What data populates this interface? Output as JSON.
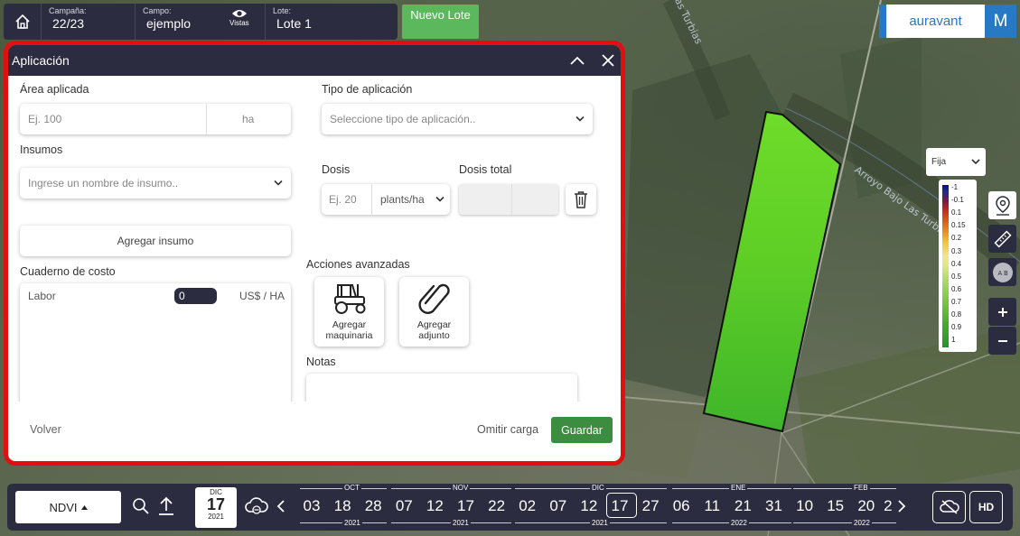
{
  "topbar": {
    "campana_label": "Campaña:",
    "campana_value": "22/23",
    "campo_label": "Campo:",
    "campo_value": "ejemplo",
    "vistas_label": "Vistas",
    "lote_label": "Lote:",
    "lote_value": "Lote 1",
    "nuevo_lote_label": "Nuevo Lote"
  },
  "brand": {
    "logo_text": "auravant",
    "user_initial": "M",
    "color": "#2779c4"
  },
  "map": {
    "labels": [
      "Las Turbias",
      "Arroyo Bajo Las Turbias"
    ]
  },
  "dialog": {
    "title": "Aplicación",
    "area": {
      "label": "Área aplicada",
      "placeholder": "Ej. 100",
      "unit": "ha"
    },
    "tipo": {
      "label": "Tipo de aplicación",
      "placeholder": "Seleccione tipo de aplicación.."
    },
    "insumos": {
      "label": "Insumos",
      "placeholder": "Ingrese un nombre de insumo.."
    },
    "dosis": {
      "label": "Dosis",
      "placeholder": "Ej. 20",
      "unit": "plants/ha"
    },
    "dosis_total": {
      "label": "Dosis total"
    },
    "agregar_insumo": "Agregar insumo",
    "cuaderno": {
      "label": "Cuaderno de costo",
      "labor_label": "Labor",
      "labor_value": "0",
      "unit": "US$ / HA"
    },
    "acciones": {
      "label": "Acciones avanzadas",
      "maquinaria": "Agregar maquinaria",
      "adjunto": "Agregar adjunto"
    },
    "notas_label": "Notas",
    "footer": {
      "volver": "Volver",
      "omitir": "Omitir carga",
      "guardar": "Guardar"
    }
  },
  "legend": {
    "mode": "Fija",
    "ticks": [
      "-1",
      "-0.1",
      "0.1",
      "0.15",
      "0.2",
      "0.3",
      "0.4",
      "0.5",
      "0.6",
      "0.7",
      "0.8",
      "0.9",
      "1"
    ]
  },
  "timeline": {
    "layer": "NDVI",
    "selected": {
      "month": "DIC",
      "day": "17",
      "year": "2021"
    },
    "days": [
      "03",
      "18",
      "28",
      "07",
      "12",
      "17",
      "22",
      "02",
      "07",
      "12",
      "17",
      "27",
      "06",
      "11",
      "21",
      "31",
      "10",
      "15",
      "20",
      "2"
    ],
    "months": [
      "OCT",
      "NOV",
      "DIC",
      "ENE",
      "FEB"
    ],
    "years": [
      "2021",
      "2021",
      "2021",
      "2022",
      "2022"
    ],
    "hd_label": "HD"
  },
  "colors": {
    "accent_green": "#3c8d40",
    "dark": "#2b2c3f",
    "highlight": "#e01010"
  }
}
